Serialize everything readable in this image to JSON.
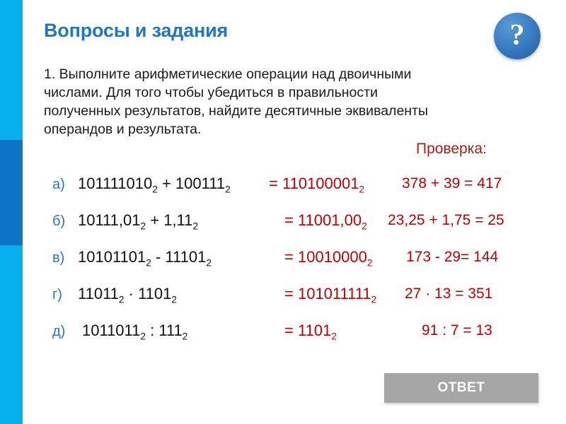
{
  "header": {
    "title": "Вопросы и задания",
    "help_icon": "question-mark-icon",
    "help_glyph": "?"
  },
  "intro": {
    "line1": "1. Выполните арифметические операции над двоичными",
    "line2": "числами. Для того чтобы убедиться в правильности",
    "line3": "полученных результатов, найдите десятичные эквиваленты",
    "line4": "операндов и результата."
  },
  "check_heading": "Проверка:",
  "equations": [
    {
      "label": "а)",
      "operand1": "101111010",
      "base1": "2",
      "operator": "+",
      "operand2": "100111",
      "base2": "2",
      "result": "110100001",
      "result_base": "2",
      "check": "378 + 39 = 417"
    },
    {
      "label": "б)",
      "operand1": "10111,01",
      "base1": "2",
      "operator": "+",
      "operand2": "1,11",
      "base2": "2",
      "result": "11001,00",
      "result_base": "2",
      "check": "23,25 + 1,75 = 25"
    },
    {
      "label": "в)",
      "operand1": "10101101",
      "base1": "2",
      "operator": "-",
      "operand2": "11101",
      "base2": "2",
      "result": "10010000",
      "result_base": "2",
      "check": "173 - 29= 144"
    },
    {
      "label": "г)",
      "operand1": "11011",
      "base1": "2",
      "operator": "·",
      "operand2": "1101",
      "base2": "2",
      "result": "101011111",
      "result_base": "2",
      "check": "27 · 13 = 351"
    },
    {
      "label": "д)",
      "operand1": "1011011",
      "base1": "2",
      "operator": ":",
      "operand2": "111",
      "base2": "2",
      "result": "1101",
      "result_base": "2",
      "check": "91 : 7 = 13"
    }
  ],
  "answer_button": {
    "label": "ОТВЕТ"
  },
  "colors": {
    "accent_light_blue": "#06AFEF",
    "accent_dark_blue": "#0B74C4",
    "title_blue": "#1F77C4",
    "label_blue": "#2E75B6",
    "result_red": "#C00000",
    "heading_red": "#A52019",
    "button_gray": "#A6A6A6"
  }
}
